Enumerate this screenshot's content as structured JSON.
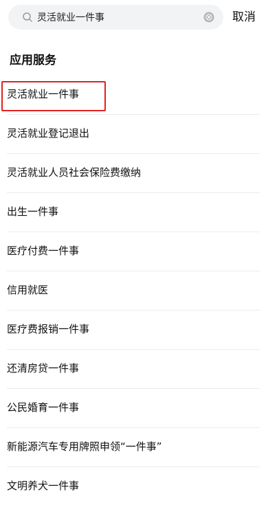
{
  "search": {
    "value": "灵活就业一件事",
    "cancel_label": "取消"
  },
  "section": {
    "title": "应用服务"
  },
  "results": [
    {
      "label": "灵活就业一件事"
    },
    {
      "label": "灵活就业登记退出"
    },
    {
      "label": "灵活就业人员社会保险费缴纳"
    },
    {
      "label": "出生一件事"
    },
    {
      "label": "医疗付费一件事"
    },
    {
      "label": "信用就医"
    },
    {
      "label": "医疗费报销一件事"
    },
    {
      "label": "还清房贷一件事"
    },
    {
      "label": "公民婚育一件事"
    },
    {
      "label": "新能源汽车专用牌照申领“一件事”"
    },
    {
      "label": "文明养犬一件事"
    }
  ],
  "highlight": {
    "color": "#e02020",
    "target_index": 0
  },
  "icons": {
    "search": "search-icon",
    "clear": "clear-icon"
  }
}
